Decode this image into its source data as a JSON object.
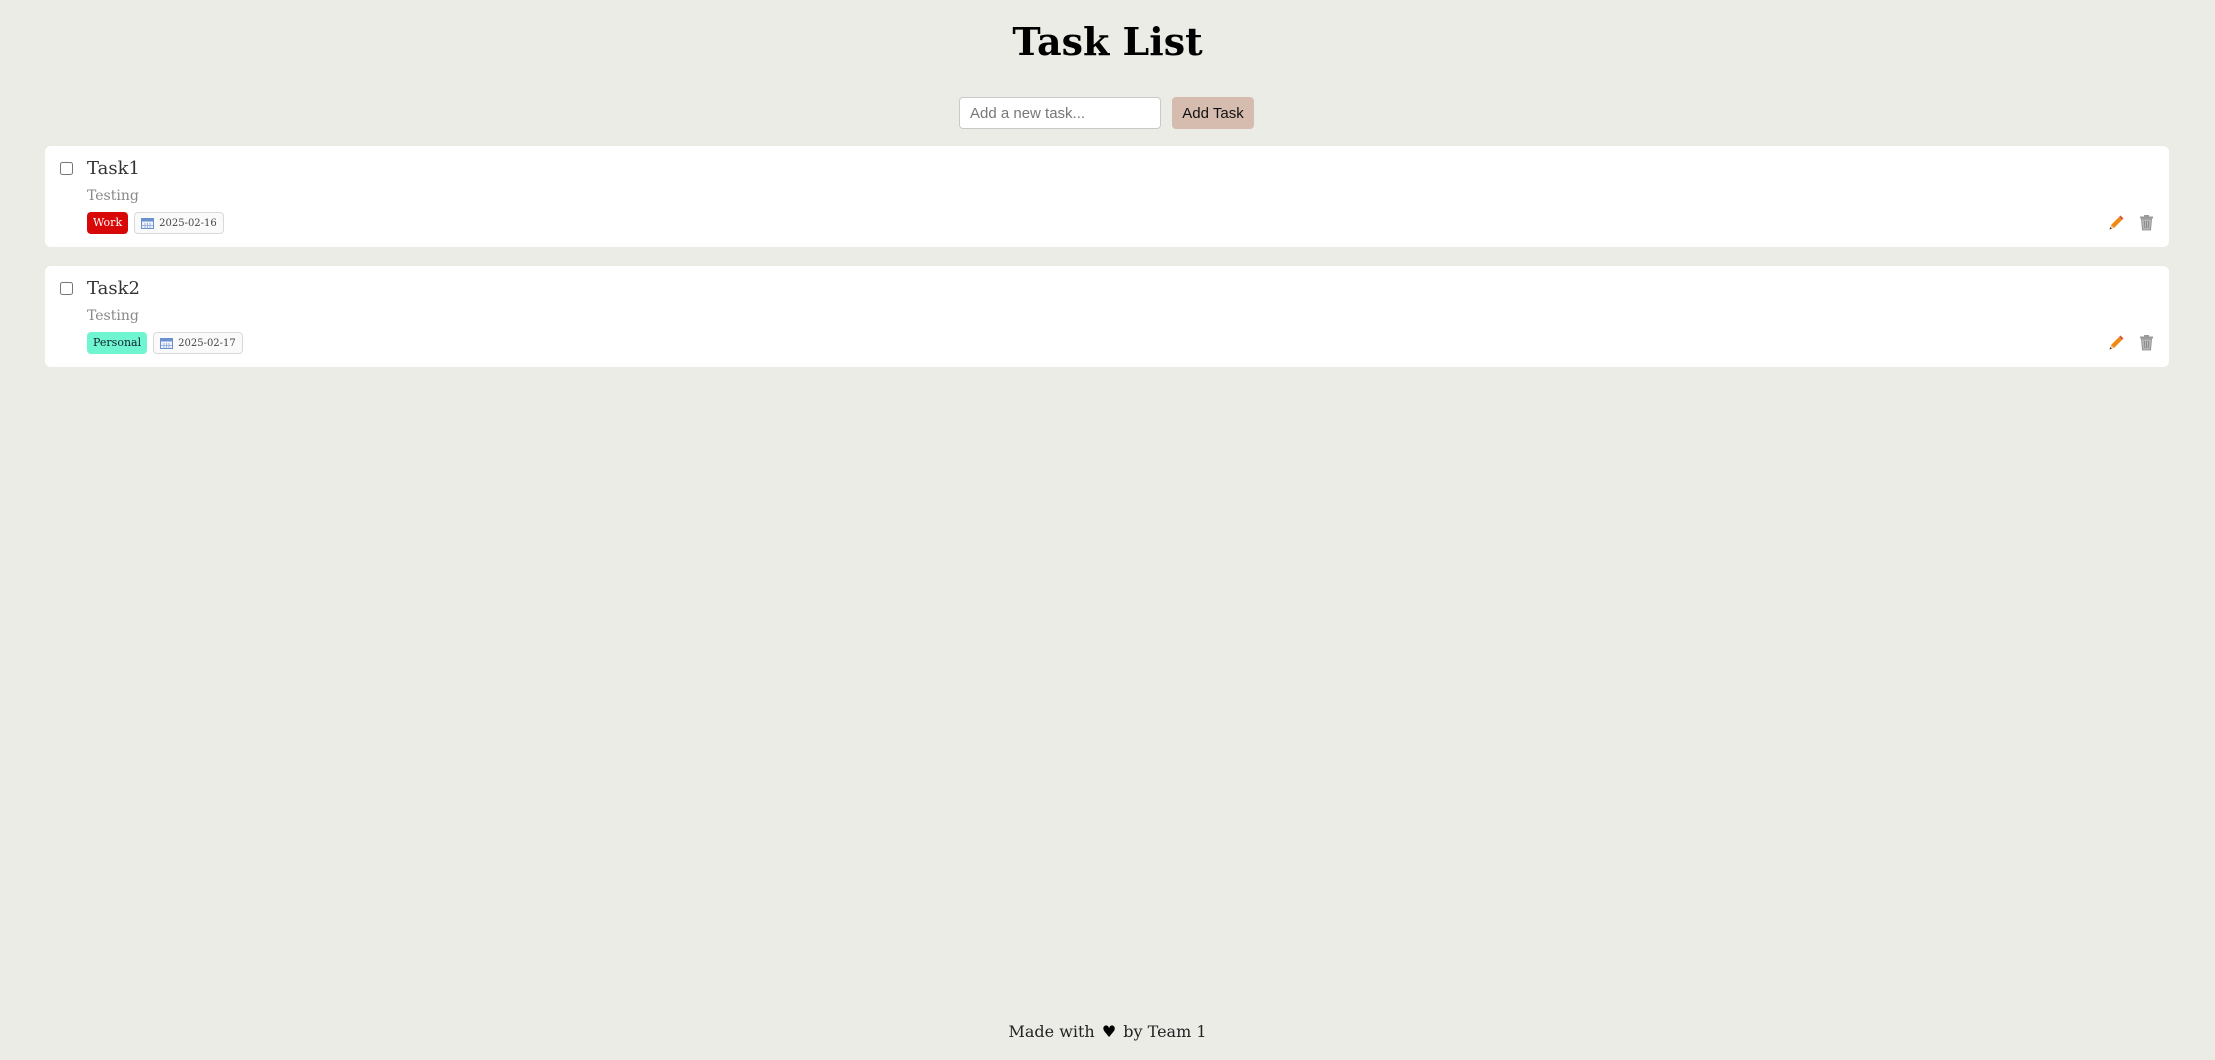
{
  "header": {
    "title": "Task List"
  },
  "add_task": {
    "placeholder": "Add a new task...",
    "value": "",
    "button_label": "Add Task"
  },
  "tasks": [
    {
      "name": "Task1",
      "description": "Testing",
      "category": "Work",
      "category_color": "#d90808",
      "due_date": "2025-02-16",
      "completed": false,
      "icons": [
        "calendar-icon",
        "edit-pencil-icon",
        "trash-icon"
      ]
    },
    {
      "name": "Task2",
      "description": "Testing",
      "category": "Personal",
      "category_color": "#6ff5cf",
      "due_date": "2025-02-17",
      "completed": false,
      "icons": [
        "calendar-icon",
        "edit-pencil-icon",
        "trash-icon"
      ]
    }
  ],
  "footer": {
    "prefix": "Made with",
    "heart": "♥",
    "suffix": "by Team 1"
  },
  "colors": {
    "background": "#ecece7",
    "card": "#ffffff",
    "add_button": "#d5bcaf",
    "edit_icon": "#f08a12",
    "delete_icon": "#9a9a9a"
  }
}
